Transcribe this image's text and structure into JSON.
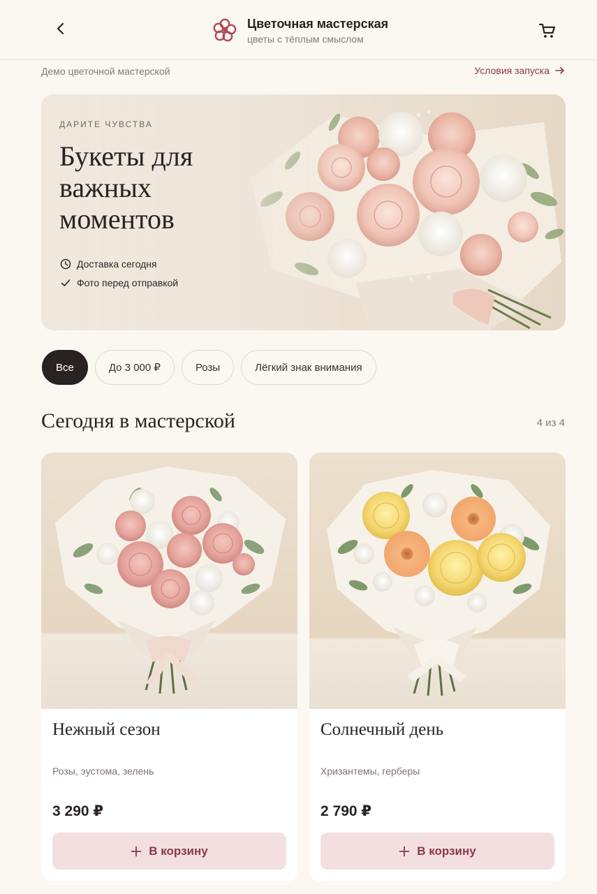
{
  "header": {
    "title": "Цветочная мастерская",
    "subtitle": "цветы с тёплым смыслом",
    "icons": {
      "back": "chevron-left-icon",
      "logo": "flower-logo-icon",
      "cart": "cart-icon"
    }
  },
  "subbar": {
    "left_text": "Демо цветочной мастерской",
    "right_link": "Условия запуска"
  },
  "hero": {
    "eyebrow": "ДАРИТЕ ЧУВСТВА",
    "title": "Букеты для важных моментов",
    "features": [
      {
        "icon": "clock-icon",
        "text": "Доставка сегодня"
      },
      {
        "icon": "check-icon",
        "text": "Фото перед отправкой"
      }
    ]
  },
  "filters": {
    "chips": [
      "Все",
      "До 3 000 ₽",
      "Розы",
      "Лёгкий знак внимания"
    ],
    "active": "Все"
  },
  "section": {
    "title": "Сегодня в мастерской",
    "count": "4 из 4"
  },
  "products": [
    {
      "name": "Нежный сезон",
      "description": "Розы, эустома, зелень",
      "price": "3 290 ₽",
      "button": "В корзину"
    },
    {
      "name": "Солнечный день",
      "description": "Хризантемы, герберы",
      "price": "2 790 ₽",
      "button": "В корзину"
    }
  ],
  "colors": {
    "background": "#fbf7f1",
    "accent": "#8a3a47",
    "button_bg": "#f3dfe0",
    "dark": "#2a2222"
  }
}
